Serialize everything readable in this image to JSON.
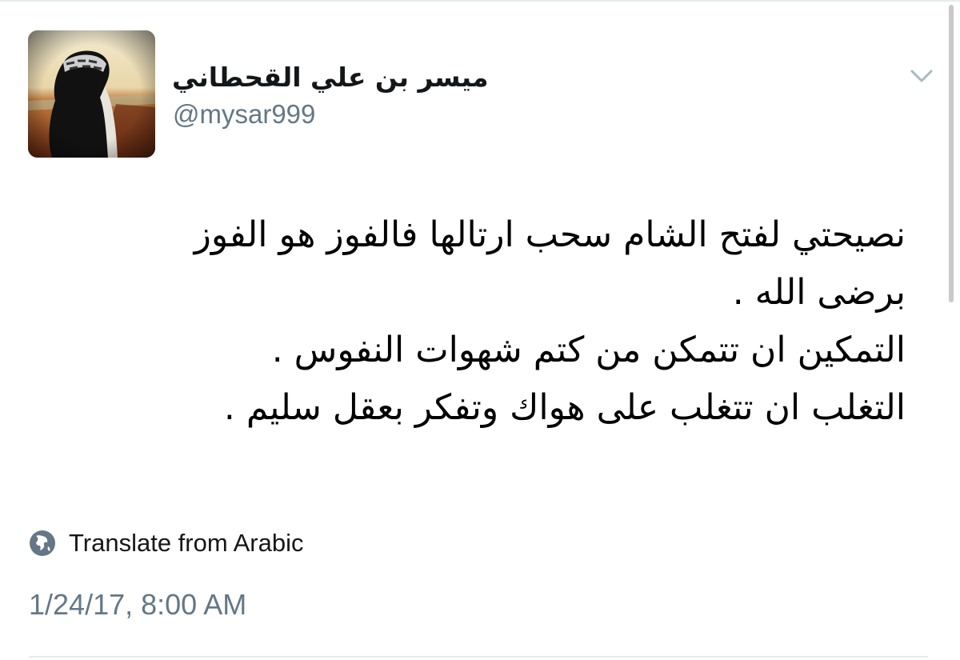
{
  "tweet": {
    "author": {
      "display_name": "ميسر بن علي القحطاني",
      "handle": "@mysar999",
      "avatar_icon": "avatar-photo"
    },
    "menu_icon": "chevron-down-icon",
    "text_lines": [
      "نصيحتي لفتح الشام سحب ارتالها فالفوز هو الفوز",
      "برضى الله .",
      "التمكين ان تتمكن من كتم شهوات النفوس .",
      "التغلب ان تتغلب على هواك وتفكر بعقل سليم ."
    ],
    "translate": {
      "icon": "globe-icon",
      "label": "Translate from Arabic"
    },
    "timestamp": "1/24/17, 8:00 AM"
  },
  "colors": {
    "primary_text": "#14171a",
    "secondary_text": "#657786",
    "divider": "#e6ecf0"
  }
}
